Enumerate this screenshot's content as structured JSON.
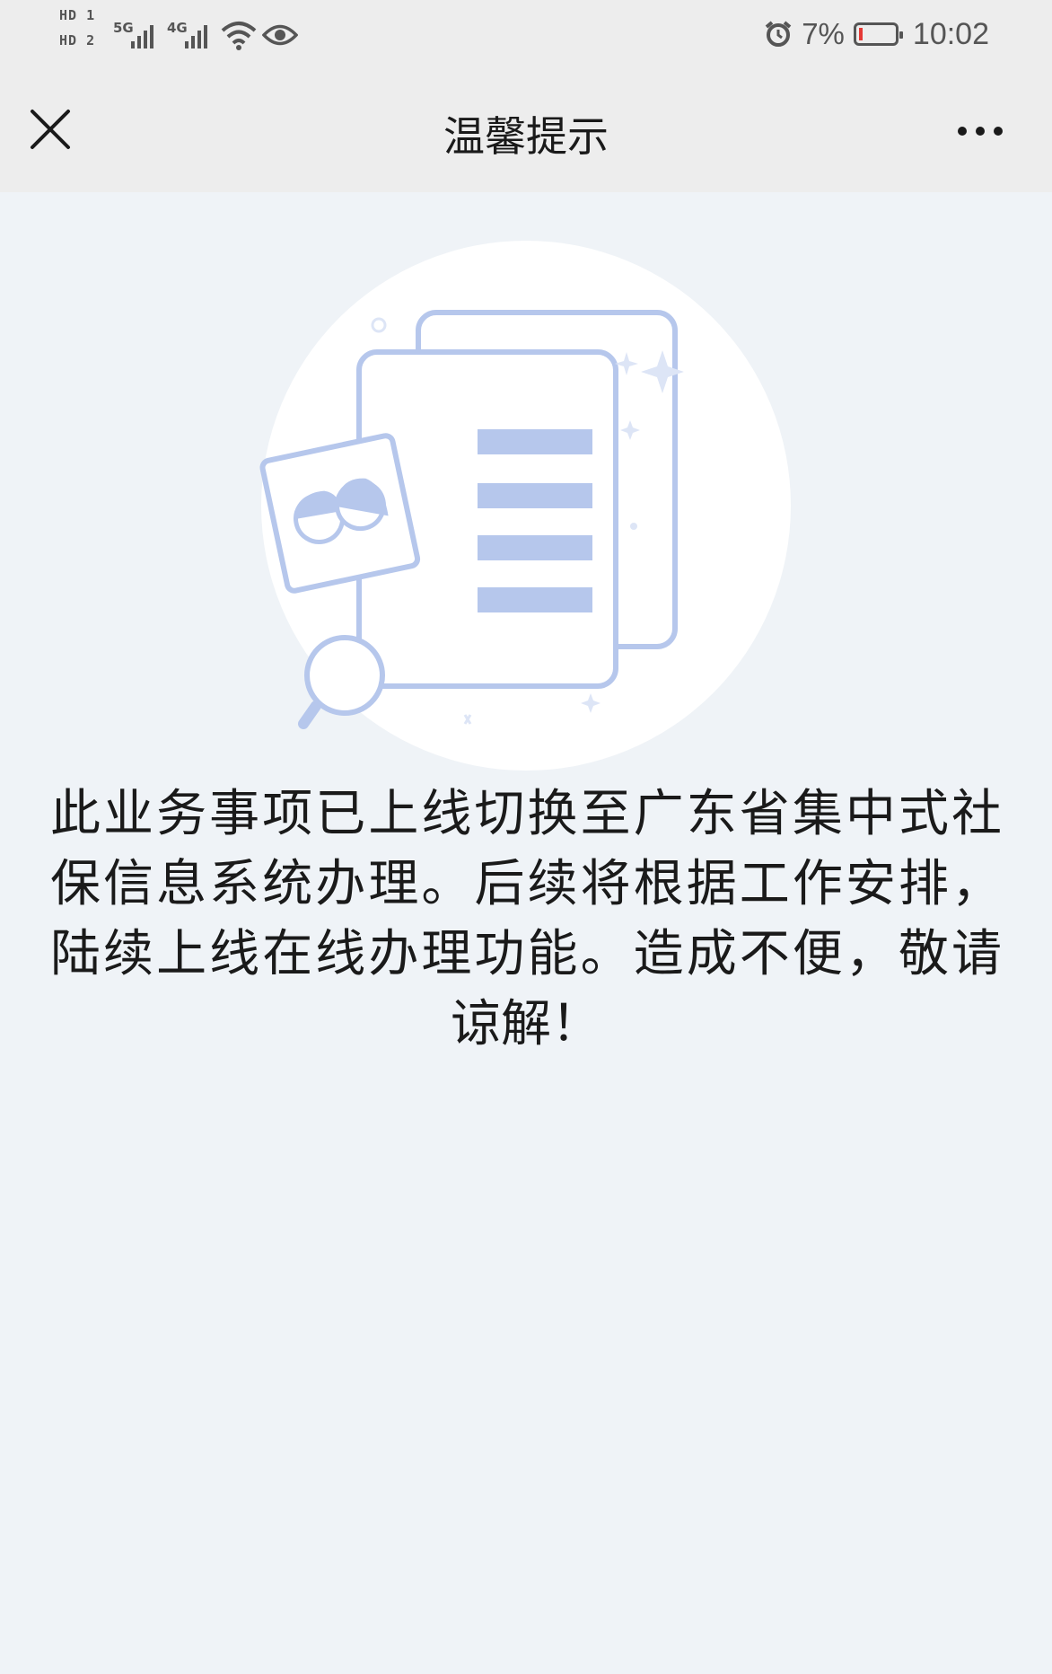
{
  "status_bar": {
    "sim1_tag": "HD 1",
    "sim2_tag": "HD 2",
    "network1": "5G",
    "network2": "4G",
    "battery_percent": "7%",
    "time": "10:02",
    "icons": [
      "alarm-icon",
      "battery-icon",
      "wifi-icon",
      "eye-icon",
      "signal-icon"
    ]
  },
  "nav": {
    "title": "温馨提示",
    "close_icon": "close-icon",
    "more_icon": "more-icon"
  },
  "notice": {
    "text": "此业务事项已上线切换至广东省集中式社保信息系统办理。后续将根据工作安排，陆续上线在线办理功能。造成不便，敬请谅解！"
  },
  "colors": {
    "page_bg": "#eff3f7",
    "header_bg": "#ededed",
    "illustration_blue": "#b6c7ec",
    "battery_low": "#e53935"
  }
}
